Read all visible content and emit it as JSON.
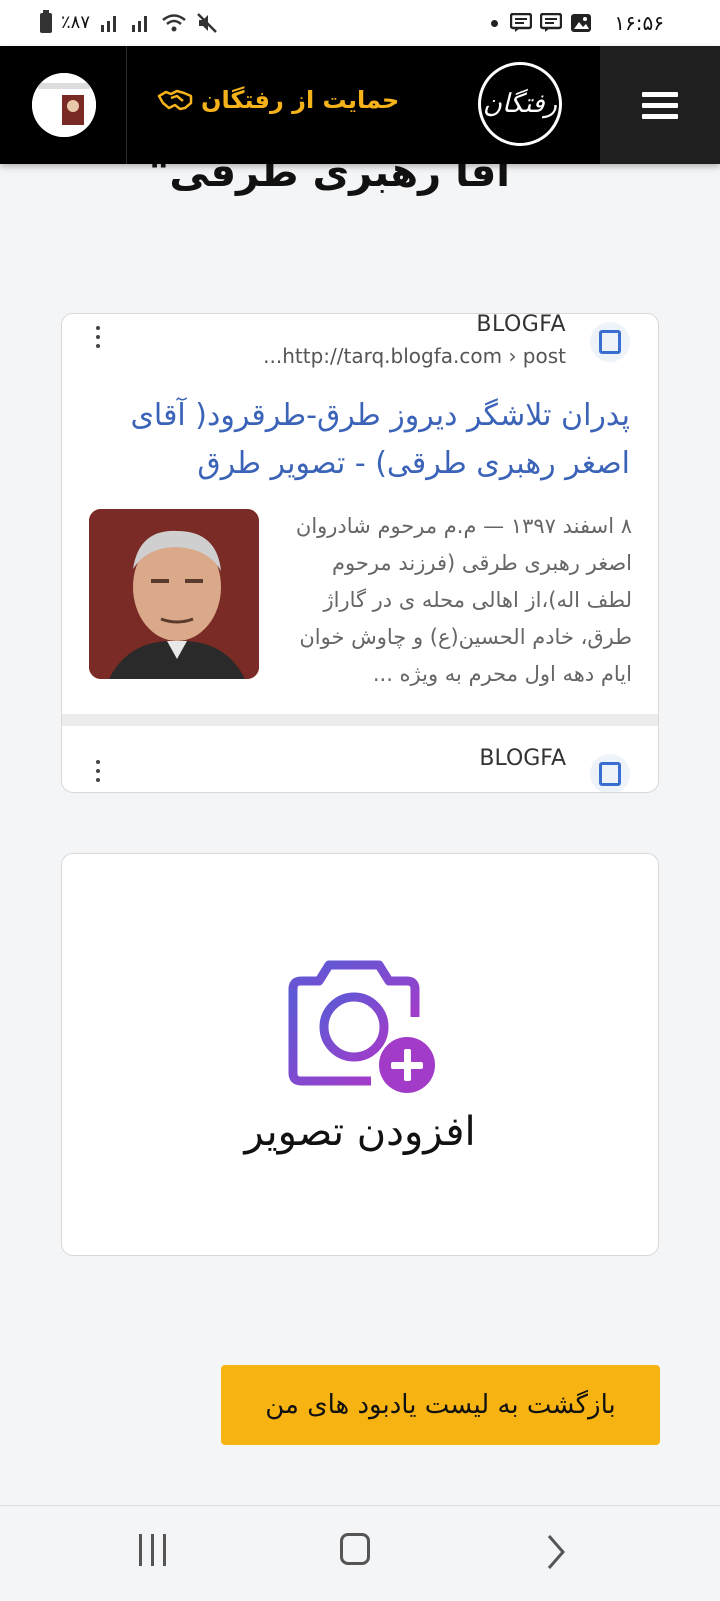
{
  "status_bar": {
    "time": "۱۶:۵۶",
    "battery": "٪۸۷"
  },
  "header": {
    "support_label": "حمایت از رفتگان",
    "logo_text": "رفتگان"
  },
  "page": {
    "title": "آقا رهبری طرقی\""
  },
  "search_result": {
    "source": "BLOGFA",
    "url": "http://tarq.blogfa.com › post...",
    "title": "پدران تلاشگر دیروز طرق-طرقرود( آقای اصغر رهبری طرقی) - تصویر طرق",
    "snippet": "۸ اسفند ۱۳۹۷ — م.م مرحوم شادروان اصغر رهبری طرقی (فرزند مرحوم لطف اله)،از اهالی محله ی در گاراژ طرق، خادم الحسین(ع) و چاوش خوان ایام دهه اول محرم به ویژه ...",
    "second_source": "BLOGFA"
  },
  "add_image": {
    "label": "افزودن تصویر"
  },
  "back_button": {
    "label": "بازگشت به لیست یادبود های من"
  },
  "colors": {
    "accent": "#f7b312",
    "header_bg": "#000000",
    "link": "#3b63b8",
    "camera_gradient_start": "#5b5bd6",
    "camera_gradient_end": "#a33bc9"
  }
}
